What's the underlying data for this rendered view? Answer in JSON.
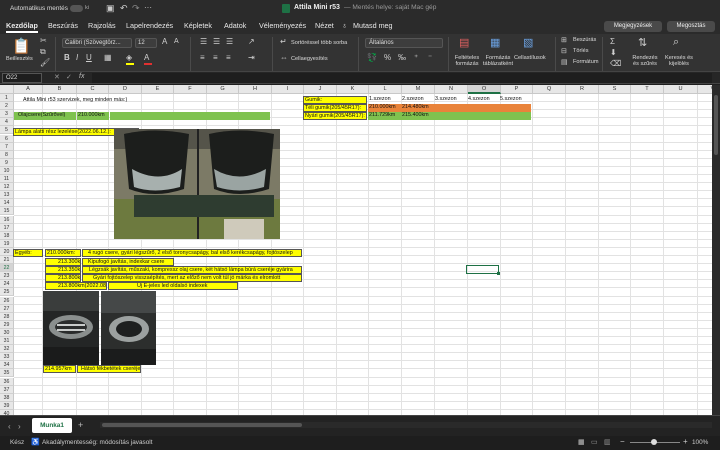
{
  "title_bar": {
    "autosave_label": "Automatikus mentés",
    "autosave_state": "ki",
    "doc_title": "Attila Mini r53",
    "doc_subtitle": "— Mentés helye: saját Mac gép",
    "search_placeholder": "Keresés (Cmd + Ctrl + U)"
  },
  "ribbon_tabs": [
    "Kezdőlap",
    "Beszúrás",
    "Rajzolás",
    "Lapelrendezés",
    "Képletek",
    "Adatok",
    "Véleményezés",
    "Nézet"
  ],
  "tell_me": "Mutasd meg",
  "comments_button": "Megjegyzések",
  "share_button": "Megosztás",
  "ribbon": {
    "paste_label": "Beillesztés",
    "font_name": "Calibri (Szövegtörz...",
    "font_size": "12",
    "wrap_label": "Sortöréssel több sorba",
    "merge_label": "Cellaegyesítés",
    "number_format": "Általános",
    "cond_format_label": "Feltételes formázás",
    "format_table_label": "Formázás táblázatként",
    "cell_styles_label": "Cellastílusok",
    "insert_label": "Beszúrás",
    "delete_label": "Törlés",
    "format_label": "Formátum",
    "sort_filter_label": "Rendezés és szűrés",
    "find_select_label": "Keresés és kijelölés"
  },
  "formula_bar": {
    "name_box": "O22",
    "fx": "fx",
    "formula": ""
  },
  "columns": [
    "A",
    "B",
    "C",
    "D",
    "E",
    "F",
    "G",
    "H",
    "I",
    "J",
    "K",
    "L",
    "M",
    "N",
    "O",
    "P",
    "Q",
    "R",
    "S",
    "T",
    "U",
    "V"
  ],
  "rows": [
    "1",
    "2",
    "3",
    "4",
    "5",
    "6",
    "7",
    "8",
    "9",
    "10",
    "11",
    "12",
    "13",
    "14",
    "15",
    "16",
    "17",
    "18",
    "19",
    "20",
    "21",
    "22",
    "23",
    "24",
    "25",
    "26",
    "27",
    "28",
    "29",
    "30",
    "31",
    "32",
    "33",
    "34",
    "35",
    "36",
    "37",
    "38",
    "39",
    "40",
    "41",
    "42",
    "43",
    "44"
  ],
  "cells": {
    "b1": "Attila Mini r53 szervizek, meg minden más:)",
    "a3": "Olajcsere(Szűrővel)",
    "c3": "210.000km",
    "a5": "Lámpa alatti rész lezelése(2022.06.12.):",
    "a20": "Egyéb:",
    "c20": "210.000km:",
    "d20": "4 rugó csere, gyári légszűrő, 2 első toronycsapágy, bal első kerékcsapágy, fojtószelep",
    "c21": "213.300km:",
    "d21": "Kipufogó javítás, indexkar csere",
    "c22": "213.350km:",
    "d22": "Légzsák javítás, műszaki, kompressz olaj csere, két hátsó lámpa búrá cseréje gyárira",
    "c23": "213.800km:",
    "d23": "Gyári fojtószelep visszaépítés, mert az előző nem volt túl jó márka és elromlott",
    "c24": "213.800km(2022.08.22):",
    "e24": "Új E-jeles led oldalsó indexek",
    "b35": "214.957km",
    "c35": "Hátsó fékbetétek cseréje",
    "k1": "Gumik:",
    "m1": "1.szezon",
    "n1": "2.szezon",
    "o1": "3.szezon",
    "p1": "4.szezon",
    "q1": "5.szezon",
    "k2": "Téli gumik(205/45R17):",
    "m2": "210.000km",
    "n2": "214.480km",
    "k3": "Nyári gumik(205/45R17):",
    "m3": "211.729km",
    "n3": "215.400km"
  },
  "sheet_tab": "Munka1",
  "status": {
    "ready": "Kész",
    "accessibility": "Akadálymentesség: módosítás javasolt",
    "zoom": "100%"
  },
  "colors": {
    "yellow": "#ffff00",
    "green": "#7fc24f",
    "orange": "#e9833a",
    "accent": "#1e7145"
  }
}
